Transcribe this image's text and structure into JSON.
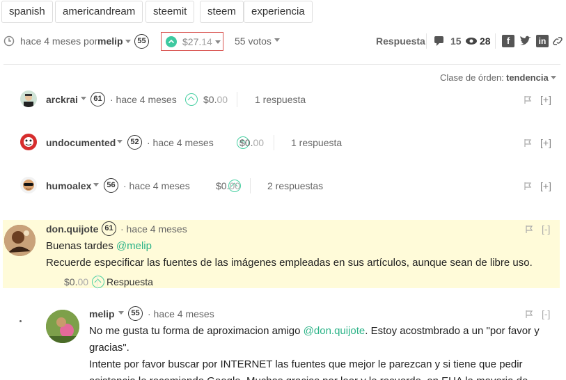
{
  "tags": [
    "spanish",
    "americandream",
    "steemit",
    "steem",
    "experiencia"
  ],
  "post_meta": {
    "time": "hace 4 meses por",
    "author": "melip",
    "rep": "55",
    "payout_main": "$27.",
    "payout_frac": "14",
    "votes": "55 votos",
    "reply_label": "Respuesta",
    "comment_count": "15",
    "view_count": "28"
  },
  "sort": {
    "label": "Clase de órden:",
    "value": "tendencia"
  },
  "collapsed_comments": [
    {
      "author": "arckrai",
      "rep": "61",
      "time": "· hace 4 meses",
      "payout_main": "$0.",
      "payout_frac": "00",
      "replies": "1 respuesta",
      "expand": "[+]"
    },
    {
      "author": "undocumented",
      "rep": "52",
      "time": "· hace 4 meses",
      "payout_main": "$0.",
      "payout_frac": "00",
      "replies": "1 respuesta",
      "expand": "[+]"
    },
    {
      "author": "humoalex",
      "rep": "56",
      "time": "· hace 4 meses",
      "payout_main": "$0.",
      "payout_frac": "00",
      "replies": "2 respuestas",
      "expand": "[+]"
    }
  ],
  "highlighted_comment": {
    "author": "don.quijote",
    "rep": "61",
    "time": "· hace 4 meses",
    "collapse": "[-]",
    "line1_prefix": "Buenas tardes ",
    "line1_mention": "@melip",
    "line2": "Recuerde especificar las fuentes de las imágenes empleadas en sus artículos, aunque sean de libre uso.",
    "payout_main": "$0.",
    "payout_frac": "00",
    "reply_label": "Respuesta"
  },
  "reply_comment": {
    "author": "melip",
    "rep": "55",
    "time": "· hace 4 meses",
    "collapse": "[-]",
    "line1_prefix": "No me gusta tu forma de aproximacion amigo ",
    "line1_mention": "@don.quijote",
    "line1_suffix": ". Estoy acostmbrado a un \"por favor y",
    "line2": "gracias\".",
    "line3": "Intente por favor buscar por INTERNET las fuentes que mejor le parezcan y si tiene que pedir",
    "line4": "asistencia le recomiendo Google. Muchas gracias por leer y le recuerdo, en EUA la mayoria de"
  },
  "colors": {
    "accent": "#4ad0a3",
    "highlight_bg": "#fffbd9",
    "payout_box": "#d9534f"
  }
}
